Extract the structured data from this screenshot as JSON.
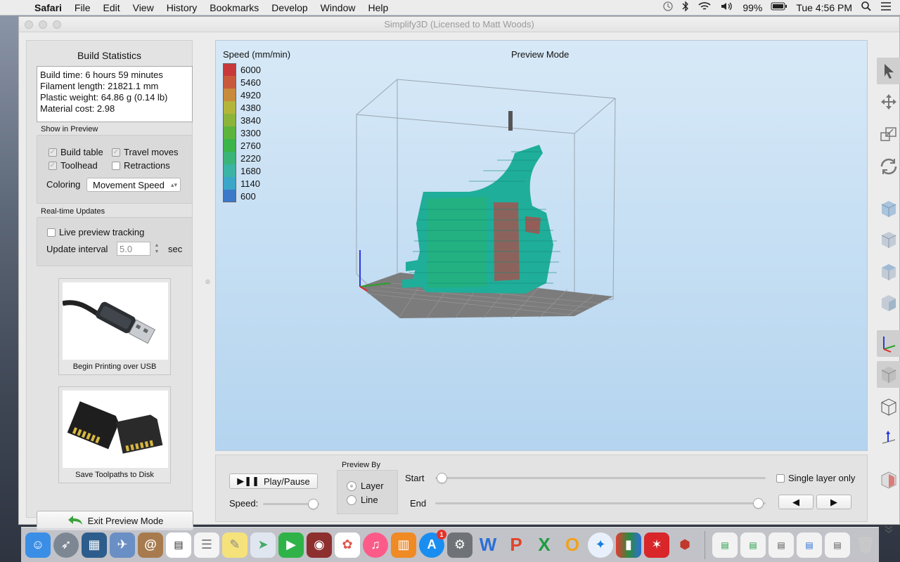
{
  "menubar": {
    "app": "Safari",
    "items": [
      "File",
      "Edit",
      "View",
      "History",
      "Bookmarks",
      "Develop",
      "Window",
      "Help"
    ],
    "battery": "99%",
    "clock": "Tue 4:56 PM"
  },
  "window": {
    "title": "Simplify3D (Licensed to Matt Woods)"
  },
  "stats": {
    "title": "Build Statistics",
    "build_time": "Build time: 6 hours 59 minutes",
    "filament_length": "Filament length: 21821.1 mm",
    "plastic_weight": "Plastic weight: 64.86 g (0.14 lb)",
    "material_cost": "Material cost: 2.98"
  },
  "show_in_preview": {
    "label": "Show in Preview",
    "build_table": "Build table",
    "travel_moves": "Travel moves",
    "toolhead": "Toolhead",
    "retractions": "Retractions",
    "coloring_label": "Coloring",
    "coloring_value": "Movement Speed"
  },
  "realtime": {
    "label": "Real-time Updates",
    "live_tracking": "Live preview tracking",
    "interval_label": "Update interval",
    "interval_value": "5.0",
    "unit": "sec"
  },
  "cards": {
    "usb": "Begin Printing over USB",
    "disk": "Save Toolpaths to Disk"
  },
  "exit_button": "Exit Preview Mode",
  "viewport": {
    "legend_title": "Speed (mm/min)",
    "mode_title": "Preview Mode",
    "legend": [
      {
        "value": "6000",
        "color": "#c8393b"
      },
      {
        "value": "5460",
        "color": "#c85a3b"
      },
      {
        "value": "4920",
        "color": "#c88a3b"
      },
      {
        "value": "4380",
        "color": "#b4b43b"
      },
      {
        "value": "3840",
        "color": "#8cb43b"
      },
      {
        "value": "3300",
        "color": "#5cb43b"
      },
      {
        "value": "2760",
        "color": "#3bb44a"
      },
      {
        "value": "2220",
        "color": "#3bb478"
      },
      {
        "value": "1680",
        "color": "#3bb4a6"
      },
      {
        "value": "1140",
        "color": "#3ba6c8"
      },
      {
        "value": "600",
        "color": "#3b78c8"
      }
    ]
  },
  "controls": {
    "play_pause": "Play/Pause",
    "speed_label": "Speed:",
    "preview_by_label": "Preview By",
    "layer": "Layer",
    "line": "Line",
    "start_label": "Start",
    "end_label": "End",
    "single_layer": "Single layer only",
    "prev": "◀",
    "next": "▶"
  }
}
